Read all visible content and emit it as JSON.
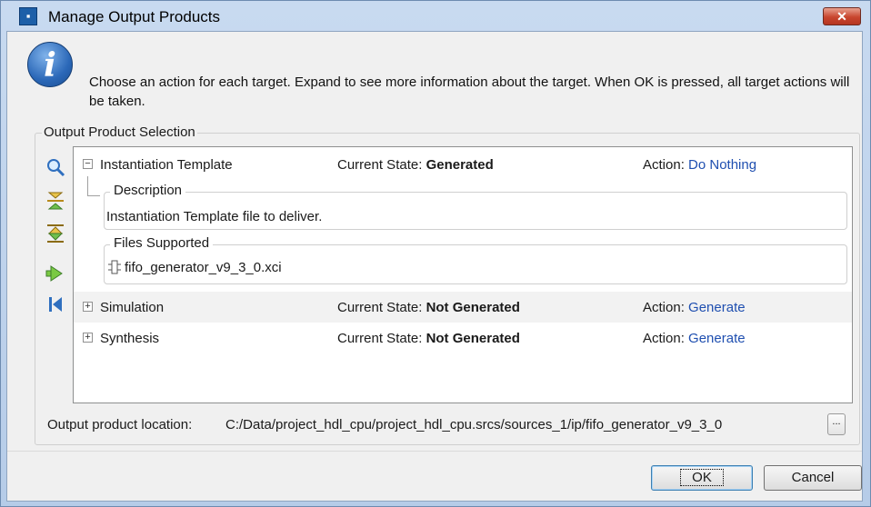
{
  "window": {
    "title": "Manage Output Products",
    "close_label": "✕"
  },
  "message": "Choose an action for each target. Expand to see more information about the target. When OK is pressed, all target actions will be taken.",
  "group_label": "Output Product Selection",
  "toolbar_icons": [
    "search-icon",
    "collapse-all-icon",
    "expand-all-icon",
    "next-icon",
    "first-icon"
  ],
  "rows": [
    {
      "label": "Instantiation Template",
      "state_label": "Current State:",
      "state": "Generated",
      "action_label": "Action:",
      "action": "Do Nothing",
      "expander": "−"
    },
    {
      "label": "Simulation",
      "state_label": "Current State:",
      "state": "Not Generated",
      "action_label": "Action:",
      "action": "Generate",
      "expander": "+"
    },
    {
      "label": "Synthesis",
      "state_label": "Current State:",
      "state": "Not Generated",
      "action_label": "Action:",
      "action": "Generate",
      "expander": "+"
    }
  ],
  "details": {
    "description_title": "Description",
    "description_text": "Instantiation Template file to deliver.",
    "files_title": "Files Supported",
    "file_name": "fifo_generator_v9_3_0.xci"
  },
  "location": {
    "label": "Output product location:",
    "path": "C:/Data/project_hdl_cpu/project_hdl_cpu.srcs/sources_1/ip/fifo_generator_v9_3_0",
    "browse_label": "..."
  },
  "buttons": {
    "ok": "OK",
    "cancel": "Cancel"
  },
  "colors": {
    "link": "#1f4fb0",
    "title_bar": "#c8daf0",
    "close": "#c8452e"
  }
}
